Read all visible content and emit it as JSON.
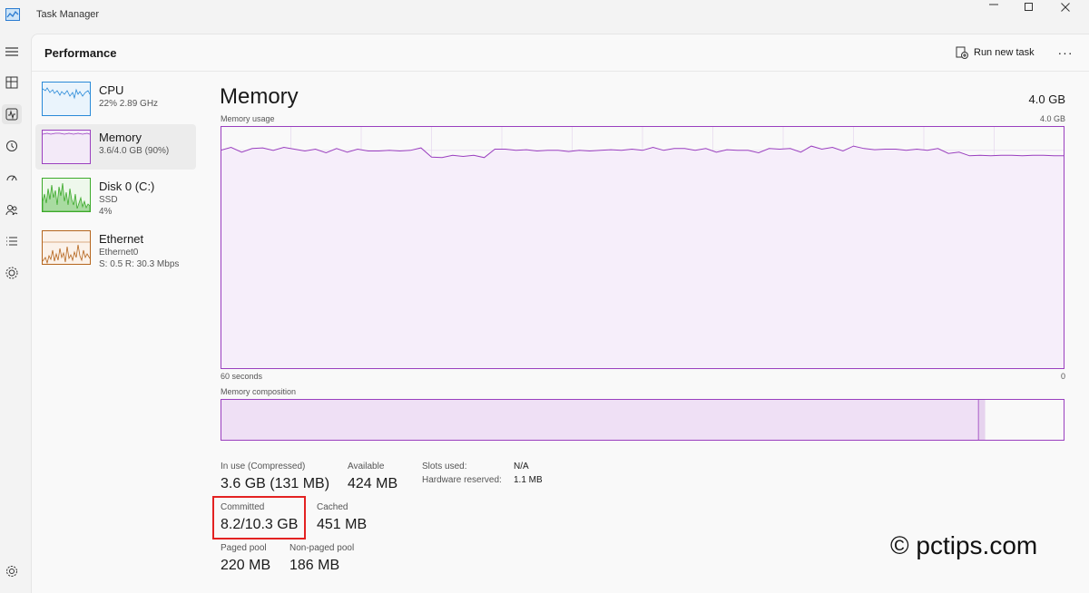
{
  "window": {
    "title": "Task Manager"
  },
  "header": {
    "page_title": "Performance",
    "run_new_task": "Run new task",
    "more": "···"
  },
  "resources": [
    {
      "name": "CPU",
      "line1": "22%  2.89 GHz",
      "line2": ""
    },
    {
      "name": "Memory",
      "line1": "3.6/4.0 GB (90%)",
      "line2": ""
    },
    {
      "name": "Disk 0 (C:)",
      "line1": "SSD",
      "line2": "4%"
    },
    {
      "name": "Ethernet",
      "line1": "Ethernet0",
      "line2": "S: 0.5  R: 30.3 Mbps"
    }
  ],
  "memory": {
    "title": "Memory",
    "total": "4.0 GB",
    "usage_label": "Memory usage",
    "usage_max": "4.0 GB",
    "time_left": "60 seconds",
    "time_right": "0",
    "composition_label": "Memory composition",
    "in_use_fraction": 0.898,
    "modified_fraction": 0.008
  },
  "chart_data": {
    "type": "area",
    "title": "Memory usage",
    "xlabel": "",
    "ylabel": "",
    "x_range_seconds": [
      60,
      0
    ],
    "ylim": [
      0,
      4.0
    ],
    "unit": "GB",
    "grid": true,
    "values": [
      3.6,
      3.65,
      3.57,
      3.63,
      3.64,
      3.6,
      3.65,
      3.62,
      3.59,
      3.62,
      3.56,
      3.63,
      3.57,
      3.62,
      3.59,
      3.59,
      3.6,
      3.59,
      3.6,
      3.64,
      3.49,
      3.48,
      3.52,
      3.5,
      3.52,
      3.48,
      3.62,
      3.62,
      3.6,
      3.61,
      3.59,
      3.6,
      3.6,
      3.58,
      3.6,
      3.59,
      3.6,
      3.61,
      3.6,
      3.62,
      3.6,
      3.65,
      3.6,
      3.63,
      3.63,
      3.6,
      3.63,
      3.57,
      3.61,
      3.6,
      3.6,
      3.56,
      3.63,
      3.62,
      3.63,
      3.57,
      3.67,
      3.62,
      3.65,
      3.59,
      3.67,
      3.63,
      3.61,
      3.62,
      3.62,
      3.6,
      3.62,
      3.6,
      3.63,
      3.55,
      3.57,
      3.51,
      3.52,
      3.51,
      3.52,
      3.52,
      3.51,
      3.52,
      3.52,
      3.51,
      3.51
    ]
  },
  "stats": {
    "in_use_label": "In use (Compressed)",
    "in_use_value": "3.6 GB (131 MB)",
    "available_label": "Available",
    "available_value": "424 MB",
    "slots_label": "Slots used:",
    "slots_value": "N/A",
    "hw_reserved_label": "Hardware reserved:",
    "hw_reserved_value": "1.1 MB",
    "committed_label": "Committed",
    "committed_value": "8.2/10.3 GB",
    "cached_label": "Cached",
    "cached_value": "451 MB",
    "paged_label": "Paged pool",
    "paged_value": "220 MB",
    "nonpaged_label": "Non-paged pool",
    "nonpaged_value": "186 MB"
  },
  "watermark": "© pctips.com",
  "colors": {
    "memory": "#9a3fbf",
    "cpu": "#2a8ad8",
    "disk": "#3caa2b",
    "ethernet": "#b5651d",
    "highlight": "#e32222"
  }
}
